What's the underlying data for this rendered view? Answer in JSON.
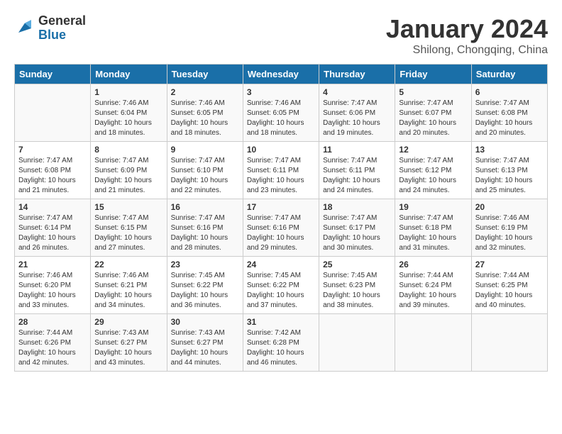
{
  "logo": {
    "line1": "General",
    "line2": "Blue"
  },
  "title": "January 2024",
  "subtitle": "Shilong, Chongqing, China",
  "days_of_week": [
    "Sunday",
    "Monday",
    "Tuesday",
    "Wednesday",
    "Thursday",
    "Friday",
    "Saturday"
  ],
  "weeks": [
    [
      {
        "day": "",
        "info": ""
      },
      {
        "day": "1",
        "info": "Sunrise: 7:46 AM\nSunset: 6:04 PM\nDaylight: 10 hours\nand 18 minutes."
      },
      {
        "day": "2",
        "info": "Sunrise: 7:46 AM\nSunset: 6:05 PM\nDaylight: 10 hours\nand 18 minutes."
      },
      {
        "day": "3",
        "info": "Sunrise: 7:46 AM\nSunset: 6:05 PM\nDaylight: 10 hours\nand 18 minutes."
      },
      {
        "day": "4",
        "info": "Sunrise: 7:47 AM\nSunset: 6:06 PM\nDaylight: 10 hours\nand 19 minutes."
      },
      {
        "day": "5",
        "info": "Sunrise: 7:47 AM\nSunset: 6:07 PM\nDaylight: 10 hours\nand 20 minutes."
      },
      {
        "day": "6",
        "info": "Sunrise: 7:47 AM\nSunset: 6:08 PM\nDaylight: 10 hours\nand 20 minutes."
      }
    ],
    [
      {
        "day": "7",
        "info": "Sunrise: 7:47 AM\nSunset: 6:08 PM\nDaylight: 10 hours\nand 21 minutes."
      },
      {
        "day": "8",
        "info": "Sunrise: 7:47 AM\nSunset: 6:09 PM\nDaylight: 10 hours\nand 21 minutes."
      },
      {
        "day": "9",
        "info": "Sunrise: 7:47 AM\nSunset: 6:10 PM\nDaylight: 10 hours\nand 22 minutes."
      },
      {
        "day": "10",
        "info": "Sunrise: 7:47 AM\nSunset: 6:11 PM\nDaylight: 10 hours\nand 23 minutes."
      },
      {
        "day": "11",
        "info": "Sunrise: 7:47 AM\nSunset: 6:11 PM\nDaylight: 10 hours\nand 24 minutes."
      },
      {
        "day": "12",
        "info": "Sunrise: 7:47 AM\nSunset: 6:12 PM\nDaylight: 10 hours\nand 24 minutes."
      },
      {
        "day": "13",
        "info": "Sunrise: 7:47 AM\nSunset: 6:13 PM\nDaylight: 10 hours\nand 25 minutes."
      }
    ],
    [
      {
        "day": "14",
        "info": "Sunrise: 7:47 AM\nSunset: 6:14 PM\nDaylight: 10 hours\nand 26 minutes."
      },
      {
        "day": "15",
        "info": "Sunrise: 7:47 AM\nSunset: 6:15 PM\nDaylight: 10 hours\nand 27 minutes."
      },
      {
        "day": "16",
        "info": "Sunrise: 7:47 AM\nSunset: 6:16 PM\nDaylight: 10 hours\nand 28 minutes."
      },
      {
        "day": "17",
        "info": "Sunrise: 7:47 AM\nSunset: 6:16 PM\nDaylight: 10 hours\nand 29 minutes."
      },
      {
        "day": "18",
        "info": "Sunrise: 7:47 AM\nSunset: 6:17 PM\nDaylight: 10 hours\nand 30 minutes."
      },
      {
        "day": "19",
        "info": "Sunrise: 7:47 AM\nSunset: 6:18 PM\nDaylight: 10 hours\nand 31 minutes."
      },
      {
        "day": "20",
        "info": "Sunrise: 7:46 AM\nSunset: 6:19 PM\nDaylight: 10 hours\nand 32 minutes."
      }
    ],
    [
      {
        "day": "21",
        "info": "Sunrise: 7:46 AM\nSunset: 6:20 PM\nDaylight: 10 hours\nand 33 minutes."
      },
      {
        "day": "22",
        "info": "Sunrise: 7:46 AM\nSunset: 6:21 PM\nDaylight: 10 hours\nand 34 minutes."
      },
      {
        "day": "23",
        "info": "Sunrise: 7:45 AM\nSunset: 6:22 PM\nDaylight: 10 hours\nand 36 minutes."
      },
      {
        "day": "24",
        "info": "Sunrise: 7:45 AM\nSunset: 6:22 PM\nDaylight: 10 hours\nand 37 minutes."
      },
      {
        "day": "25",
        "info": "Sunrise: 7:45 AM\nSunset: 6:23 PM\nDaylight: 10 hours\nand 38 minutes."
      },
      {
        "day": "26",
        "info": "Sunrise: 7:44 AM\nSunset: 6:24 PM\nDaylight: 10 hours\nand 39 minutes."
      },
      {
        "day": "27",
        "info": "Sunrise: 7:44 AM\nSunset: 6:25 PM\nDaylight: 10 hours\nand 40 minutes."
      }
    ],
    [
      {
        "day": "28",
        "info": "Sunrise: 7:44 AM\nSunset: 6:26 PM\nDaylight: 10 hours\nand 42 minutes."
      },
      {
        "day": "29",
        "info": "Sunrise: 7:43 AM\nSunset: 6:27 PM\nDaylight: 10 hours\nand 43 minutes."
      },
      {
        "day": "30",
        "info": "Sunrise: 7:43 AM\nSunset: 6:27 PM\nDaylight: 10 hours\nand 44 minutes."
      },
      {
        "day": "31",
        "info": "Sunrise: 7:42 AM\nSunset: 6:28 PM\nDaylight: 10 hours\nand 46 minutes."
      },
      {
        "day": "",
        "info": ""
      },
      {
        "day": "",
        "info": ""
      },
      {
        "day": "",
        "info": ""
      }
    ]
  ]
}
